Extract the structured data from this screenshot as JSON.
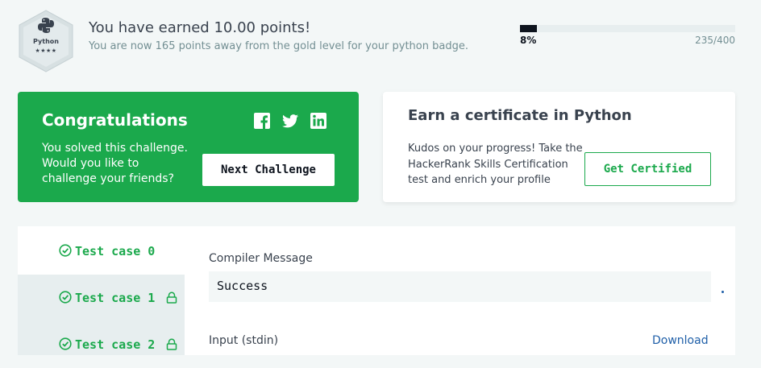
{
  "header": {
    "badge": {
      "language": "Python",
      "stars": "★★★★",
      "icon": "python-logo-icon"
    },
    "title": "You have earned 10.00 points!",
    "subtitle": "You are now 165 points away from the gold level for your python badge.",
    "progress": {
      "fraction": 0.08,
      "percent_label": "8%",
      "count_label": "235/400"
    }
  },
  "congrats": {
    "title": "Congratulations",
    "text": "You solved this challenge. Would you like to challenge your friends?",
    "button": "Next Challenge",
    "social_icons": [
      "facebook-icon",
      "twitter-icon",
      "linkedin-icon"
    ],
    "color": "#1ba94c"
  },
  "certificate": {
    "title": "Earn a certificate in Python",
    "text": "Kudos on your progress! Take the HackerRank Skills Certification test and enrich your profile",
    "button": "Get Certified"
  },
  "test_cases": [
    {
      "label": "Test case 0",
      "status": "passed",
      "locked": false,
      "active": true
    },
    {
      "label": "Test case 1",
      "status": "passed",
      "locked": true,
      "active": false
    },
    {
      "label": "Test case 2",
      "status": "passed",
      "locked": true,
      "active": false
    }
  ],
  "result": {
    "compiler_label": "Compiler Message",
    "compiler_value": "Success",
    "input_label": "Input (stdin)",
    "download_label": "Download"
  }
}
